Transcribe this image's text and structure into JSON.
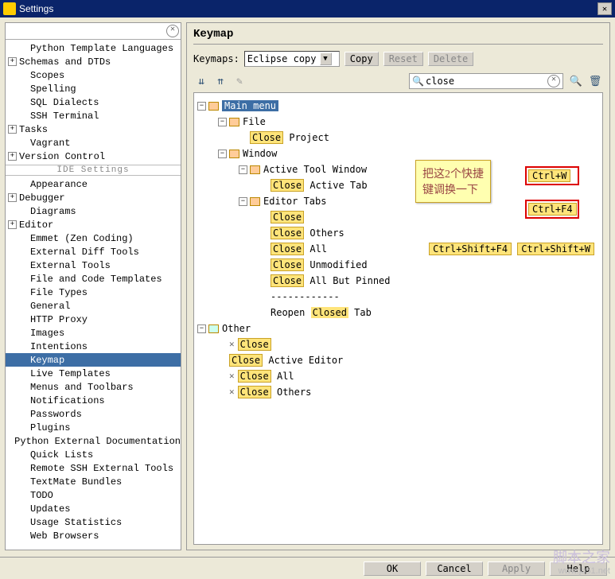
{
  "window": {
    "title": "Settings"
  },
  "sidebar": {
    "search": "",
    "ide_header": "IDE Settings",
    "items_top": [
      {
        "label": "Python Template Languages",
        "exp": null,
        "i": 1
      },
      {
        "label": "Schemas and DTDs",
        "exp": "+",
        "i": 0
      },
      {
        "label": "Scopes",
        "exp": null,
        "i": 1
      },
      {
        "label": "Spelling",
        "exp": null,
        "i": 1
      },
      {
        "label": "SQL Dialects",
        "exp": null,
        "i": 1
      },
      {
        "label": "SSH Terminal",
        "exp": null,
        "i": 1
      },
      {
        "label": "Tasks",
        "exp": "+",
        "i": 0
      },
      {
        "label": "Vagrant",
        "exp": null,
        "i": 1
      },
      {
        "label": "Version Control",
        "exp": "+",
        "i": 0
      }
    ],
    "items_ide": [
      {
        "label": "Appearance",
        "exp": null,
        "i": 1
      },
      {
        "label": "Debugger",
        "exp": "+",
        "i": 0
      },
      {
        "label": "Diagrams",
        "exp": null,
        "i": 1
      },
      {
        "label": "Editor",
        "exp": "+",
        "i": 0
      },
      {
        "label": "Emmet (Zen Coding)",
        "exp": null,
        "i": 1
      },
      {
        "label": "External Diff Tools",
        "exp": null,
        "i": 1
      },
      {
        "label": "External Tools",
        "exp": null,
        "i": 1
      },
      {
        "label": "File and Code Templates",
        "exp": null,
        "i": 1
      },
      {
        "label": "File Types",
        "exp": null,
        "i": 1
      },
      {
        "label": "General",
        "exp": null,
        "i": 1
      },
      {
        "label": "HTTP Proxy",
        "exp": null,
        "i": 1
      },
      {
        "label": "Images",
        "exp": null,
        "i": 1
      },
      {
        "label": "Intentions",
        "exp": null,
        "i": 1
      },
      {
        "label": "Keymap",
        "exp": null,
        "i": 1,
        "sel": true
      },
      {
        "label": "Live Templates",
        "exp": null,
        "i": 1
      },
      {
        "label": "Menus and Toolbars",
        "exp": null,
        "i": 1
      },
      {
        "label": "Notifications",
        "exp": null,
        "i": 1
      },
      {
        "label": "Passwords",
        "exp": null,
        "i": 1
      },
      {
        "label": "Plugins",
        "exp": null,
        "i": 1
      },
      {
        "label": "Python External Documentation",
        "exp": null,
        "i": 1
      },
      {
        "label": "Quick Lists",
        "exp": null,
        "i": 1
      },
      {
        "label": "Remote SSH External Tools",
        "exp": null,
        "i": 1
      },
      {
        "label": "TextMate Bundles",
        "exp": null,
        "i": 1
      },
      {
        "label": "TODO",
        "exp": null,
        "i": 1
      },
      {
        "label": "Updates",
        "exp": null,
        "i": 1
      },
      {
        "label": "Usage Statistics",
        "exp": null,
        "i": 1
      },
      {
        "label": "Web Browsers",
        "exp": null,
        "i": 1
      }
    ]
  },
  "main": {
    "title": "Keymap",
    "keymaps_label": "Keymaps:",
    "keymaps_value": "Eclipse copy",
    "copy": "Copy",
    "reset": "Reset",
    "delete": "Delete",
    "search_value": "close",
    "root": "Main menu",
    "file": "File",
    "close_project": {
      "hl": "Close",
      "txt": " Project"
    },
    "window": "Window",
    "atw": "Active Tool Window",
    "close_atab": {
      "hl": "Close",
      "txt": " Active Tab"
    },
    "editor_tabs": "Editor Tabs",
    "et": [
      {
        "hl": "Close",
        "txt": ""
      },
      {
        "hl": "Close",
        "txt": " Others"
      },
      {
        "hl": "Close",
        "txt": " All"
      },
      {
        "hl": "Close",
        "txt": " Unmodified"
      },
      {
        "hl": "Close",
        "txt": " All But Pinned"
      }
    ],
    "dashes": "------------",
    "reopen": {
      "pre": "Reopen ",
      "hl": "Closed",
      "post": " Tab"
    },
    "other": "Other",
    "oth": [
      {
        "hl": "Close",
        "txt": ""
      },
      {
        "hl": "Close",
        "txt": " Active Editor"
      },
      {
        "hl": "Close",
        "txt": " All"
      },
      {
        "hl": "Close",
        "txt": " Others"
      }
    ],
    "shortcuts": {
      "ctrlw": "Ctrl+W",
      "ctrlf4": "Ctrl+F4",
      "csf4": "Ctrl+Shift+F4",
      "csw": "Ctrl+Shift+W"
    },
    "annotation": "把这2个快捷\n键调换一下"
  },
  "buttons": {
    "ok": "OK",
    "cancel": "Cancel",
    "apply": "Apply",
    "help": "Help"
  },
  "watermark": {
    "ch": "脚本之家",
    "url": "www.jb51.net"
  }
}
